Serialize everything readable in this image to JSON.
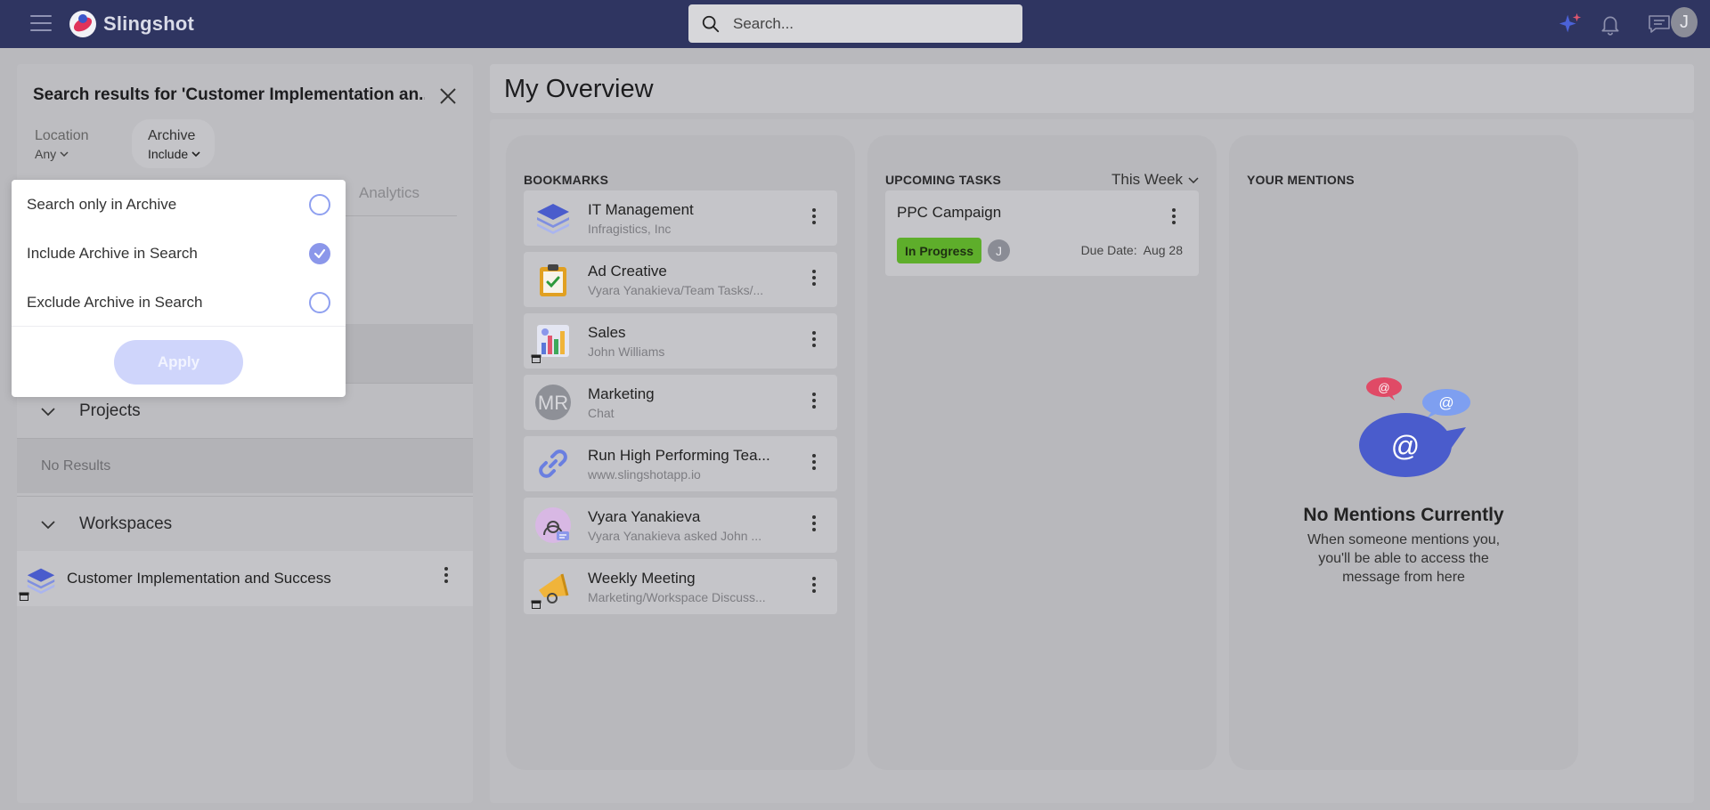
{
  "app": {
    "name": "Slingshot"
  },
  "search": {
    "placeholder": "Search..."
  },
  "user": {
    "initial": "J"
  },
  "left_panel": {
    "title": "Search results for 'Customer Implementation an...",
    "filters": {
      "location": {
        "label": "Location",
        "value": "Any"
      },
      "archive": {
        "label": "Archive",
        "value": "Include"
      }
    },
    "tabs": {
      "analytics": "Analytics"
    },
    "sections": {
      "projects": {
        "label": "Projects",
        "empty": "No Results"
      },
      "workspaces": {
        "label": "Workspaces",
        "items": [
          "Customer Implementation and Success"
        ]
      }
    }
  },
  "archive_dropdown": {
    "options": [
      {
        "label": "Search only in Archive",
        "checked": false
      },
      {
        "label": "Include Archive in Search",
        "checked": true
      },
      {
        "label": "Exclude Archive in Search",
        "checked": false
      }
    ],
    "apply_label": "Apply"
  },
  "overview": {
    "title": "My Overview",
    "bookmarks": {
      "title": "BOOKMARKS",
      "items": [
        {
          "name": "IT Management",
          "sub": "Infragistics, Inc",
          "icon": "layers-icon"
        },
        {
          "name": "Ad Creative",
          "sub": "Vyara Yanakieva/Team Tasks/...",
          "icon": "clipboard-icon"
        },
        {
          "name": "Sales",
          "sub": "John Williams",
          "icon": "chart-icon"
        },
        {
          "name": "Marketing",
          "sub": "Chat",
          "icon": "chat-avatar-icon",
          "initials": "MR"
        },
        {
          "name": "Run High Performing Tea...",
          "sub": "www.slingshotapp.io",
          "icon": "link-icon"
        },
        {
          "name": "Vyara Yanakieva",
          "sub": "Vyara Yanakieva asked John ...",
          "icon": "user-message-icon"
        },
        {
          "name": "Weekly Meeting",
          "sub": "Marketing/Workspace Discuss...",
          "icon": "megaphone-icon"
        }
      ]
    },
    "tasks": {
      "title": "UPCOMING TASKS",
      "range": "This Week",
      "items": [
        {
          "name": "PPC Campaign",
          "status": "In Progress",
          "assignee": "J",
          "due_label": "Due Date:",
          "due": "Aug 28"
        }
      ]
    },
    "mentions": {
      "title": "YOUR MENTIONS",
      "empty_title": "No Mentions Currently",
      "empty_text": "When someone mentions you, you'll be able to access the message from here"
    }
  },
  "colors": {
    "topbar": "#2f3561",
    "accent": "#8b97ea",
    "status_in_progress": "#5eae2b"
  }
}
